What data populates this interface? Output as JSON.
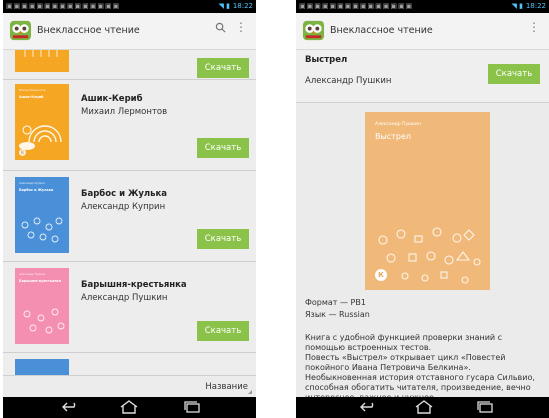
{
  "status_bar": {
    "time": "18:22"
  },
  "app": {
    "title": "Внеклассное чтение"
  },
  "books": [
    {
      "title": "Ашик-Кериб",
      "author": "Михаил Лермонтов",
      "cover_color": "#f5a623",
      "cover_author": "Михаил Лермонтов",
      "cover_title": "Ашик-Кериб"
    },
    {
      "title": "Барбос и Жулька",
      "author": "Александр Куприн",
      "cover_color": "#4a90d9",
      "cover_author": "Александр Куприн",
      "cover_title": "Барбос и Жулька"
    },
    {
      "title": "Барышня-крестьянка",
      "author": "Александр Пушкин",
      "cover_color": "#f48fb1",
      "cover_author": "Александр Пушкин",
      "cover_title": "Барышня-крестьянка"
    }
  ],
  "download_label": "Скачать",
  "sort": {
    "label": "Название"
  },
  "detail": {
    "title": "Выстрел",
    "author": "Александр Пушкин",
    "cover_author": "Александр Пушкин",
    "cover_title": "Выстрел",
    "cover_badge": "К",
    "format": "Формат — PB1",
    "language": "Язык — Russian",
    "description_1": "Книга с удобной функцией проверки знаний с помощью встроенных тестов.",
    "description_2": "Повесть «Выстрел» открывает цикл «Повестей покойного Ивана Петровича Белкина». Необыкновенная история отставного гусара Сильвио, способная обогатить читателя, произведение, вечно интересное, важное и нужное."
  },
  "colors": {
    "accent": "#8bc34a",
    "status_blue": "#4fc3f7",
    "detail_cover": "#f0b97a"
  }
}
